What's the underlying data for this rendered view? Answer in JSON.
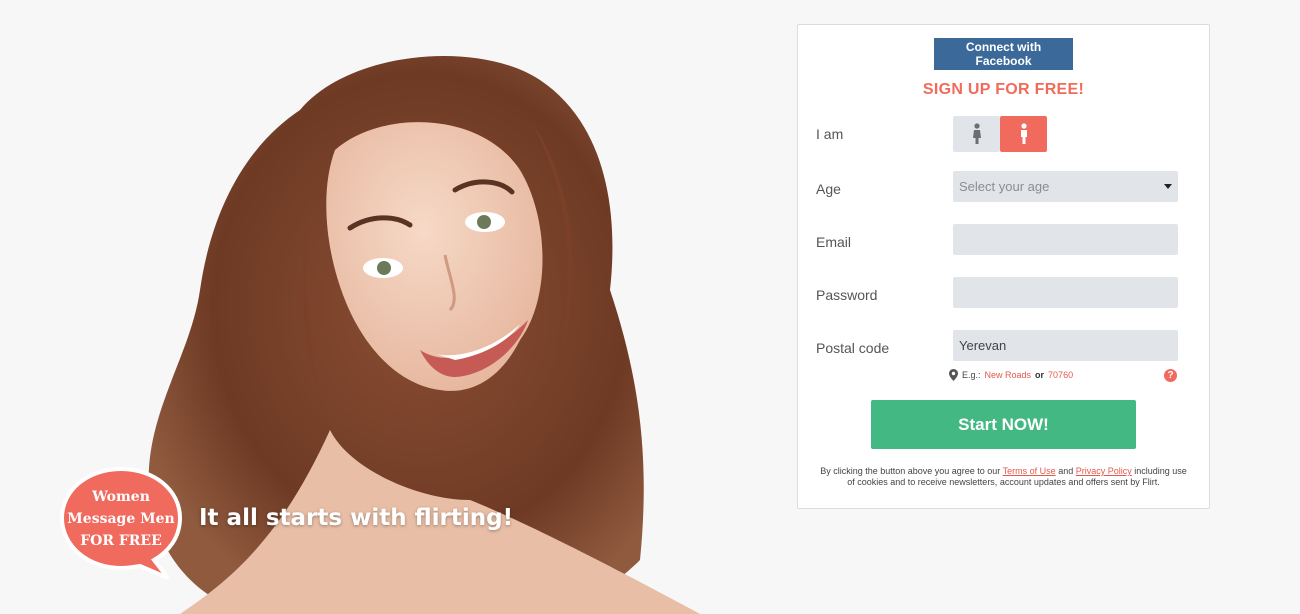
{
  "hero": {
    "bubble_lines": [
      "Women",
      "Message Men",
      "FOR FREE"
    ],
    "tagline": "It all starts with flirting!"
  },
  "signup": {
    "facebook_label": "Connect with Facebook",
    "title": "SIGN UP FOR FREE!",
    "gender_label": "I am",
    "gender_options": [
      "female-icon",
      "male-icon"
    ],
    "gender_selected": "male",
    "age_label": "Age",
    "age_placeholder": "Select your age",
    "email_label": "Email",
    "email_value": "",
    "password_label": "Password",
    "password_value": "",
    "postal_label": "Postal code",
    "postal_value": "Yerevan",
    "hint_prefix": "E.g.:",
    "hint_example_1": "New Roads",
    "hint_or": "or",
    "hint_example_2": "70760",
    "help_icon": "?",
    "start_label": "Start NOW!",
    "legal_1": "By clicking the button above you agree to our",
    "terms_link": "Terms of Use",
    "legal_and": "and",
    "privacy_link": "Privacy Policy",
    "legal_2": "including use of cookies and to receive newsletters, account updates and offers sent by Flirt."
  },
  "colors": {
    "facebook": "#3b6a9a",
    "accent": "#f16b5b",
    "start": "#44b883",
    "field_bg": "#e1e5e9"
  }
}
